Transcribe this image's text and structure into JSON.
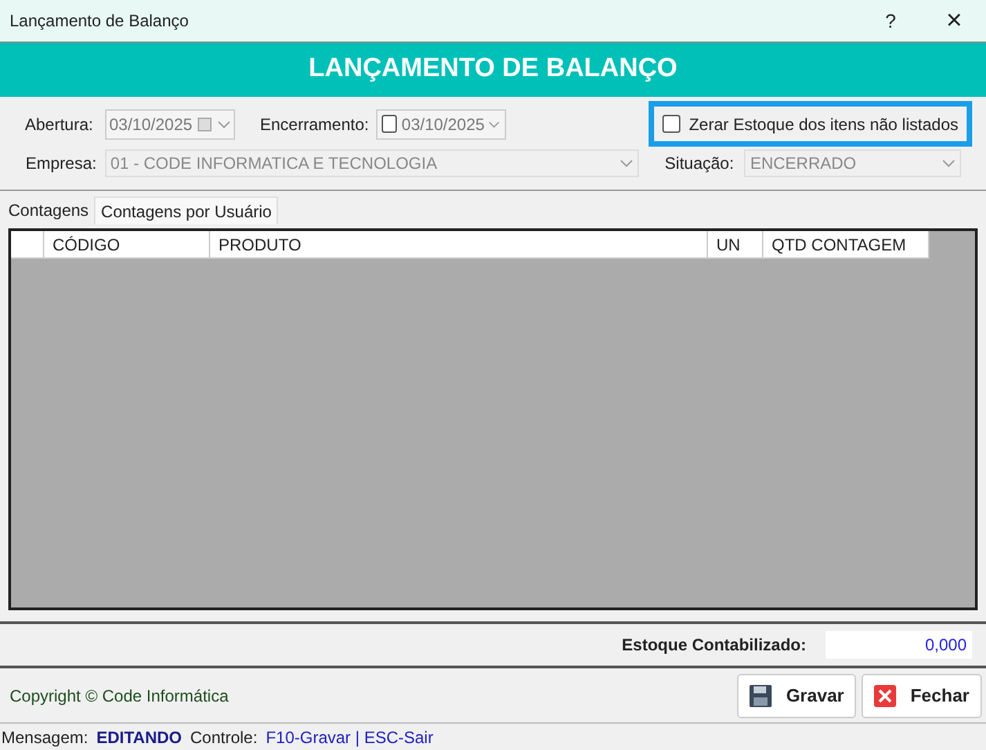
{
  "window": {
    "title": "Lançamento de Balanço",
    "help": "?",
    "close": "×"
  },
  "header": "LANÇAMENTO DE BALANÇO",
  "form": {
    "abertura": {
      "label": "Abertura:",
      "value": "03/10/2025"
    },
    "encerramento": {
      "label": "Encerramento:",
      "value": "03/10/2025",
      "checked": false
    },
    "zerar": {
      "label": "Zerar Estoque dos itens não listados",
      "checked": false
    },
    "empresa": {
      "label": "Empresa:",
      "value": "01 - CODE INFORMATICA E TECNOLOGIA"
    },
    "situacao": {
      "label": "Situação:",
      "value": "ENCERRADO"
    }
  },
  "tabs": [
    {
      "label": "Contagens",
      "selected": true
    },
    {
      "label": "Contagens por Usuário",
      "selected": false
    }
  ],
  "table": {
    "columns": [
      "CÓDIGO",
      "PRODUTO",
      "UN",
      "QTD CONTAGEM"
    ]
  },
  "total": {
    "label": "Estoque Contabilizado:",
    "value": "0,000"
  },
  "copyright": "Copyright © Code Informática",
  "buttons": [
    {
      "kind": "save",
      "label": "Gravar"
    },
    {
      "kind": "close",
      "label": "Fechar"
    }
  ],
  "status": {
    "label": "Mensagem:",
    "message": "EDITANDO",
    "controls_label": "Controle:",
    "controls": "F10-Gravar | ESC-Sair"
  }
}
